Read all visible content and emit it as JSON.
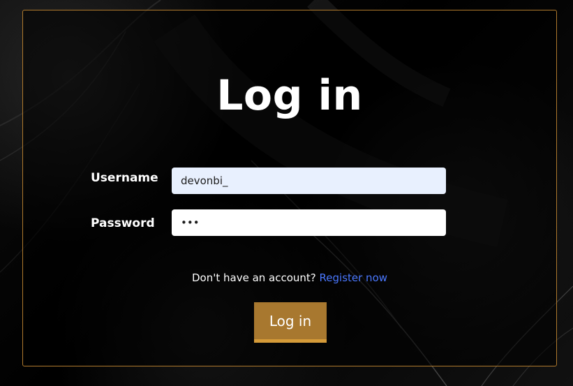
{
  "login": {
    "title": "Log in",
    "username_label": "Username",
    "username_value": "devonbi_",
    "password_label": "Password",
    "password_value": "•••",
    "register_prompt": "Don't have an account? ",
    "register_link": "Register now",
    "submit_label": "Log in"
  },
  "colors": {
    "accent": "#a8782f",
    "frame_border": "#b07a2d",
    "link": "#4a78ff",
    "username_field_bg": "#e8f0fe"
  }
}
